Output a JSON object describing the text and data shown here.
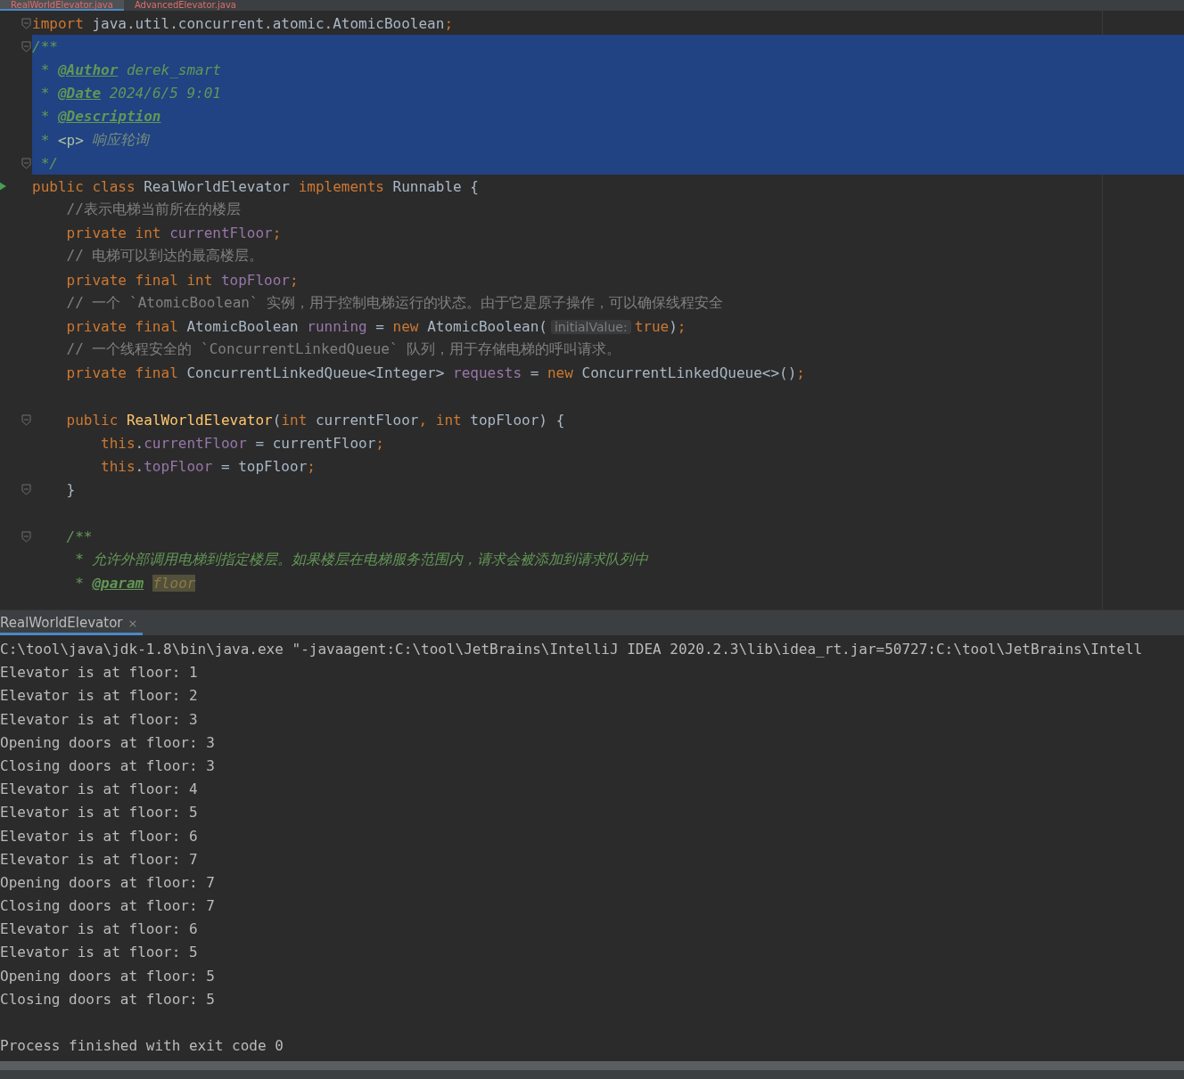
{
  "editor_tabs": [
    {
      "label": "RealWorldElevator.java",
      "selected": true
    },
    {
      "label": "AdvancedElevator.java",
      "selected": false
    }
  ],
  "code_lines": [
    {
      "selected": false,
      "fold_marker": true,
      "tokens": [
        {
          "kind": "kw",
          "text": "import "
        },
        {
          "kind": "plain",
          "text": "java.util.concurrent.atomic.AtomicBoolean"
        },
        {
          "kind": "kw",
          "text": ";"
        }
      ]
    },
    {
      "selected": true,
      "fold_marker": true,
      "tokens": [
        {
          "kind": "doc",
          "text": "/**"
        }
      ]
    },
    {
      "selected": true,
      "tokens": [
        {
          "kind": "doc",
          "text": " * "
        },
        {
          "kind": "doctag",
          "text": "@Author"
        },
        {
          "kind": "doc",
          "text": " derek_smart"
        }
      ]
    },
    {
      "selected": true,
      "tokens": [
        {
          "kind": "doc",
          "text": " * "
        },
        {
          "kind": "doctag",
          "text": "@Date"
        },
        {
          "kind": "doc",
          "text": " 2024/6/5 9:01"
        }
      ]
    },
    {
      "selected": true,
      "tokens": [
        {
          "kind": "doc",
          "text": " * "
        },
        {
          "kind": "doctag",
          "text": "@Description"
        }
      ]
    },
    {
      "selected": true,
      "tokens": [
        {
          "kind": "doc",
          "text": " * "
        },
        {
          "kind": "htmltag",
          "text": "<p>"
        },
        {
          "kind": "docdim",
          "text": " 响应轮询"
        }
      ]
    },
    {
      "selected": true,
      "fold_marker": true,
      "tokens": [
        {
          "kind": "doc",
          "text": " */"
        }
      ]
    },
    {
      "selected": false,
      "run_marker": true,
      "tokens": [
        {
          "kind": "kw",
          "text": "public class "
        },
        {
          "kind": "plain",
          "text": "RealWorldElevator "
        },
        {
          "kind": "kw",
          "text": "implements "
        },
        {
          "kind": "plain",
          "text": "Runnable {"
        }
      ]
    },
    {
      "selected": false,
      "tokens": [
        {
          "kind": "comment",
          "text": "    //表示电梯当前所在的楼层"
        }
      ]
    },
    {
      "selected": false,
      "tokens": [
        {
          "kind": "kw",
          "text": "    private int "
        },
        {
          "kind": "field",
          "text": "currentFloor"
        },
        {
          "kind": "kw",
          "text": ";"
        }
      ]
    },
    {
      "selected": false,
      "tokens": [
        {
          "kind": "comment",
          "text": "    // 电梯可以到达的最高楼层。"
        }
      ]
    },
    {
      "selected": false,
      "tokens": [
        {
          "kind": "kw",
          "text": "    private final int "
        },
        {
          "kind": "field",
          "text": "topFloor"
        },
        {
          "kind": "kw",
          "text": ";"
        }
      ]
    },
    {
      "selected": false,
      "tokens": [
        {
          "kind": "comment",
          "text": "    // 一个 `AtomicBoolean` 实例，用于控制电梯运行的状态。由于它是原子操作，可以确保线程安全"
        }
      ]
    },
    {
      "selected": false,
      "tokens": [
        {
          "kind": "kw",
          "text": "    private final "
        },
        {
          "kind": "plain",
          "text": "AtomicBoolean "
        },
        {
          "kind": "field",
          "text": "running"
        },
        {
          "kind": "plain",
          "text": " = "
        },
        {
          "kind": "kw",
          "text": "new "
        },
        {
          "kind": "plain",
          "text": "AtomicBoolean("
        },
        {
          "kind": "hint",
          "text": "initialValue:"
        },
        {
          "kind": "kw",
          "text": "true"
        },
        {
          "kind": "plain",
          "text": ")"
        },
        {
          "kind": "kw",
          "text": ";"
        }
      ]
    },
    {
      "selected": false,
      "tokens": [
        {
          "kind": "comment",
          "text": "    // 一个线程安全的 `ConcurrentLinkedQueue` 队列，用于存储电梯的呼叫请求。"
        }
      ]
    },
    {
      "selected": false,
      "tokens": [
        {
          "kind": "kw",
          "text": "    private final "
        },
        {
          "kind": "plain",
          "text": "ConcurrentLinkedQueue<Integer> "
        },
        {
          "kind": "field",
          "text": "requests"
        },
        {
          "kind": "plain",
          "text": " = "
        },
        {
          "kind": "kw",
          "text": "new "
        },
        {
          "kind": "plain",
          "text": "ConcurrentLinkedQueue<>()"
        },
        {
          "kind": "kw",
          "text": ";"
        }
      ]
    },
    {
      "selected": false,
      "blank_line_before": true,
      "fold_marker": true,
      "tokens": [
        {
          "kind": "kw",
          "text": "    public "
        },
        {
          "kind": "method",
          "text": "RealWorldElevator"
        },
        {
          "kind": "plain",
          "text": "("
        },
        {
          "kind": "kw",
          "text": "int "
        },
        {
          "kind": "plain",
          "text": "currentFloor"
        },
        {
          "kind": "kw",
          "text": ", int "
        },
        {
          "kind": "plain",
          "text": "topFloor) {"
        }
      ]
    },
    {
      "selected": false,
      "tokens": [
        {
          "kind": "kw",
          "text": "        this"
        },
        {
          "kind": "plain",
          "text": "."
        },
        {
          "kind": "field",
          "text": "currentFloor"
        },
        {
          "kind": "plain",
          "text": " = currentFloor"
        },
        {
          "kind": "kw",
          "text": ";"
        }
      ]
    },
    {
      "selected": false,
      "tokens": [
        {
          "kind": "kw",
          "text": "        this"
        },
        {
          "kind": "plain",
          "text": "."
        },
        {
          "kind": "field",
          "text": "topFloor"
        },
        {
          "kind": "plain",
          "text": " = topFloor"
        },
        {
          "kind": "kw",
          "text": ";"
        }
      ]
    },
    {
      "selected": false,
      "fold_marker": true,
      "tokens": [
        {
          "kind": "plain",
          "text": "    }"
        }
      ]
    },
    {
      "selected": false,
      "blank_line_before": true,
      "fold_marker": true,
      "tokens": [
        {
          "kind": "doc",
          "text": "    /**"
        }
      ]
    },
    {
      "selected": false,
      "tokens": [
        {
          "kind": "doc",
          "text": "     * 允许外部调用电梯到指定楼层。如果楼层在电梯服务范围内，请求会被添加到请求队列中"
        }
      ]
    },
    {
      "selected": false,
      "tokens": [
        {
          "kind": "doc",
          "text": "     * "
        },
        {
          "kind": "doctag",
          "text": "@param"
        },
        {
          "kind": "paramref",
          "text": "floor"
        }
      ]
    }
  ],
  "run_panel": {
    "tab": "RealWorldElevator",
    "close": "×",
    "output": [
      "C:\\tool\\java\\jdk-1.8\\bin\\java.exe \"-javaagent:C:\\tool\\JetBrains\\IntelliJ IDEA 2020.2.3\\lib\\idea_rt.jar=50727:C:\\tool\\JetBrains\\Intell",
      "Elevator is at floor: 1",
      "Elevator is at floor: 2",
      "Elevator is at floor: 3",
      "Opening doors at floor: 3",
      "Closing doors at floor: 3",
      "Elevator is at floor: 4",
      "Elevator is at floor: 5",
      "Elevator is at floor: 6",
      "Elevator is at floor: 7",
      "Opening doors at floor: 7",
      "Closing doors at floor: 7",
      "Elevator is at floor: 6",
      "Elevator is at floor: 5",
      "Opening doors at floor: 5",
      "Closing doors at floor: 5"
    ],
    "exit_message": "Process finished with exit code 0"
  }
}
